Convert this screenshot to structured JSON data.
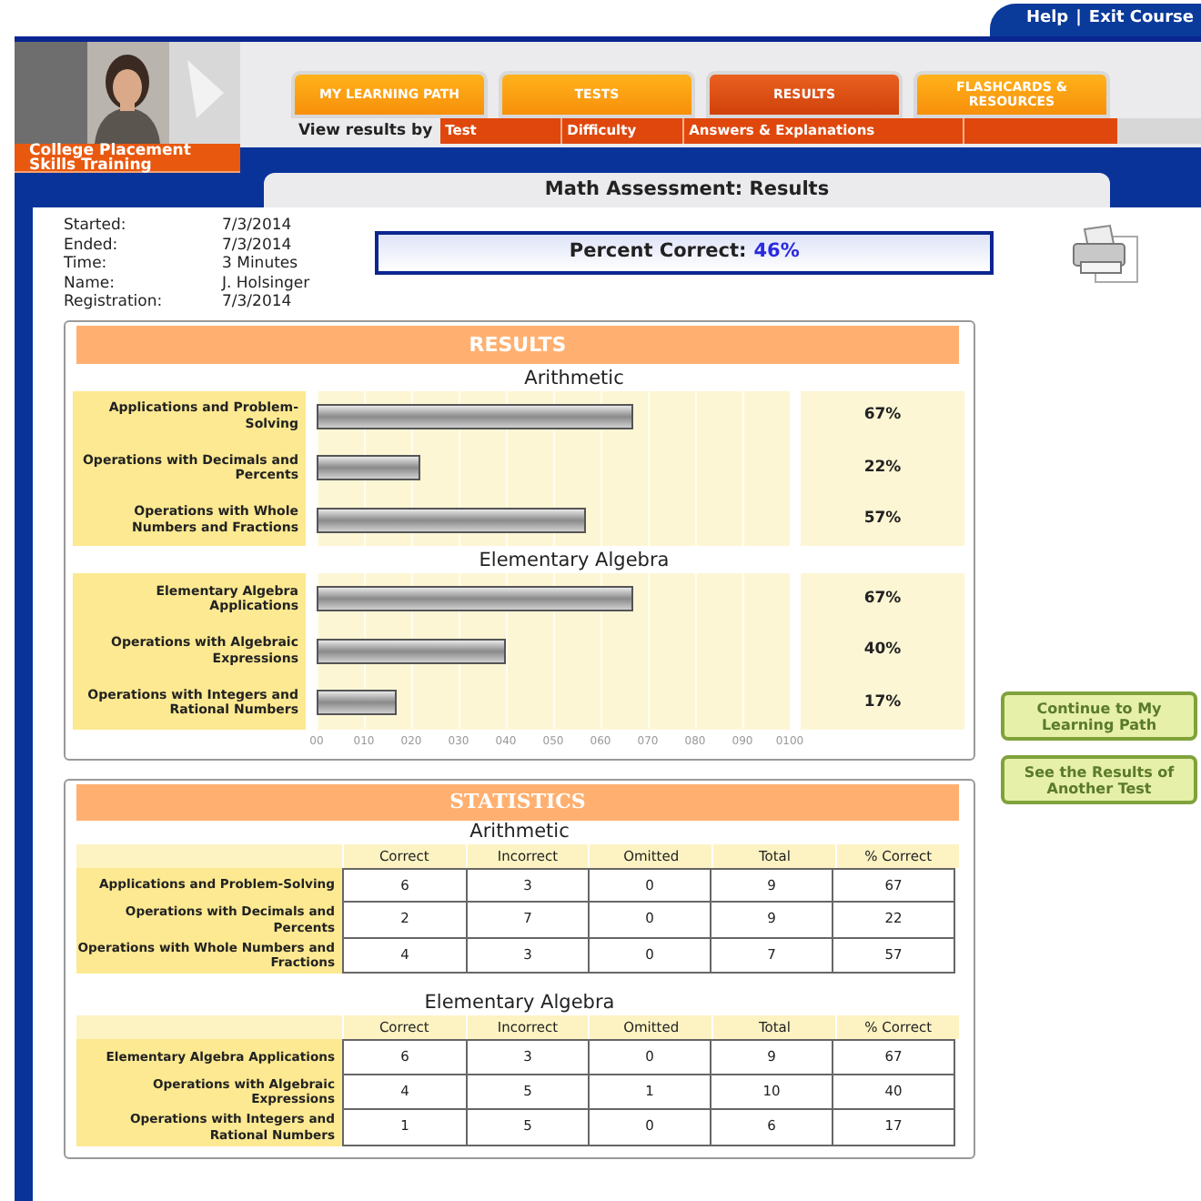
{
  "top_links": [
    "Help",
    "|",
    "Exit Course"
  ],
  "brand": "College Placement Skills Training",
  "tabs": [
    {
      "label": "MY LEARNING PATH",
      "selected": false
    },
    {
      "label": "TESTS",
      "selected": false
    },
    {
      "label": "RESULTS",
      "selected": true
    },
    {
      "label": "FLASHCARDS & RESOURCES",
      "selected": false
    }
  ],
  "view_by": {
    "label": "View results by",
    "links": [
      "Test",
      "Difficulty",
      "Answers & Explanations"
    ]
  },
  "page_title": "Math Assessment: Results",
  "info": [
    {
      "label": "Started:",
      "value": "7/3/2014"
    },
    {
      "label": "Ended:",
      "value": "7/3/2014"
    },
    {
      "label": "Time:",
      "value": "3 Minutes"
    },
    {
      "label": "Name:",
      "value": "J. Holsinger"
    },
    {
      "label": "Registration:",
      "value": "7/3/2014"
    }
  ],
  "percent_correct": {
    "label": "Percent Correct:",
    "value": "46%"
  },
  "results": {
    "title": "RESULTS",
    "groups": [
      {
        "title": "Arithmetic",
        "percents": [
          "67%",
          "22%",
          "57%"
        ]
      },
      {
        "title": "Elementary Algebra",
        "percents": [
          "67%",
          "40%",
          "17%"
        ]
      }
    ],
    "chart_data": {
      "type": "bar",
      "orientation": "horizontal",
      "categories": [
        "Applications and Problem-Solving",
        "Operations with Decimals and Percents",
        "Operations with Whole Numbers and Fractions",
        "Elementary Algebra Applications",
        "Operations with Algebraic Expressions",
        "Operations with Integers and Rational Numbers"
      ],
      "values": [
        67,
        22,
        57,
        67,
        40,
        17
      ],
      "xlim": [
        0,
        100
      ],
      "grid": true,
      "xticks": [
        {
          "value": 0,
          "label": "00"
        },
        {
          "value": 10,
          "label": "010"
        },
        {
          "value": 20,
          "label": "020"
        },
        {
          "value": 30,
          "label": "030"
        },
        {
          "value": 40,
          "label": "040"
        },
        {
          "value": 50,
          "label": "050"
        },
        {
          "value": 60,
          "label": "060"
        },
        {
          "value": 70,
          "label": "070"
        },
        {
          "value": 80,
          "label": "080"
        },
        {
          "value": 90,
          "label": "090"
        },
        {
          "value": 100,
          "label": "0100"
        }
      ]
    }
  },
  "buttons": [
    "Continue to My Learning Path",
    "See the Results of Another Test"
  ],
  "statistics": {
    "title": "STATISTICS",
    "groups": [
      {
        "title": "Arithmetic",
        "columns": [
          "Correct",
          "Incorrect",
          "Omitted",
          "Total",
          "% Correct"
        ],
        "rows": [
          {
            "label": "Applications and Problem-Solving",
            "cells": [
              "6",
              "3",
              "0",
              "9",
              "67"
            ]
          },
          {
            "label": "Operations with Decimals and Percents",
            "cells": [
              "2",
              "7",
              "0",
              "9",
              "22"
            ]
          },
          {
            "label": "Operations with Whole Numbers and Fractions",
            "cells": [
              "4",
              "3",
              "0",
              "7",
              "57"
            ]
          }
        ]
      },
      {
        "title": "Elementary Algebra",
        "columns": [
          "Correct",
          "Incorrect",
          "Omitted",
          "Total",
          "% Correct"
        ],
        "rows": [
          {
            "label": "Elementary Algebra Applications",
            "cells": [
              "6",
              "3",
              "0",
              "9",
              "67"
            ]
          },
          {
            "label": "Operations with Algebraic Expressions",
            "cells": [
              "4",
              "5",
              "1",
              "10",
              "40"
            ]
          },
          {
            "label": "Operations with Integers and Rational Numbers",
            "cells": [
              "1",
              "5",
              "0",
              "6",
              "17"
            ]
          }
        ]
      }
    ]
  }
}
